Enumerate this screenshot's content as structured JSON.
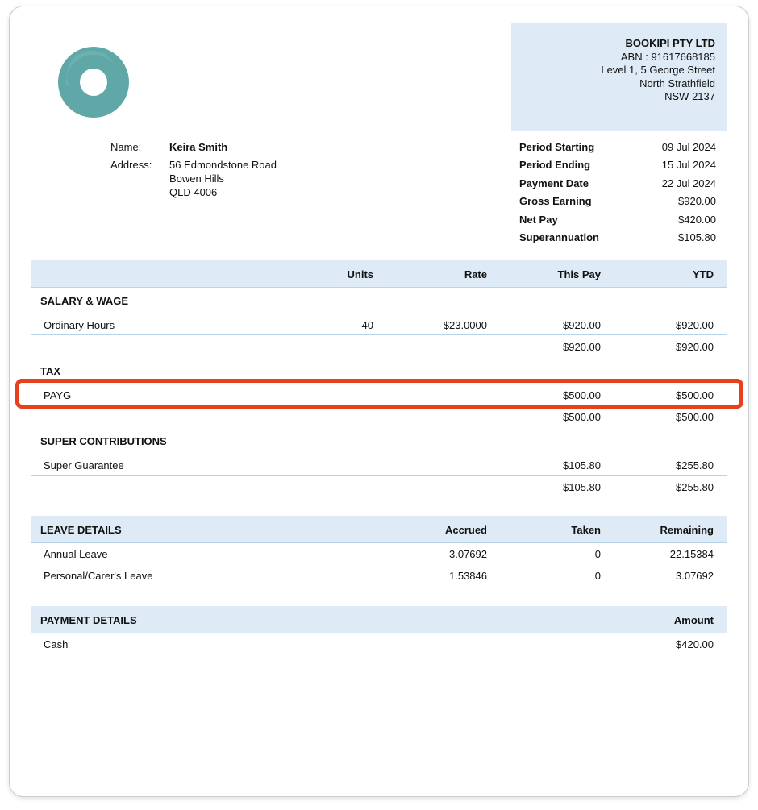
{
  "company": {
    "name": "BOOKIPI PTY LTD",
    "abn": "ABN : 91617668185",
    "address_line1": "Level 1, 5 George Street",
    "address_line2": "North Strathfield",
    "address_line3": "NSW 2137"
  },
  "employee": {
    "name_label": "Name:",
    "name": "Keira Smith",
    "address_label": "Address:",
    "address_line1": "56 Edmondstone Road",
    "address_line2": "Bowen Hills",
    "address_line3": "QLD 4006"
  },
  "summary": [
    {
      "label": "Period Starting",
      "value": "09 Jul 2024"
    },
    {
      "label": "Period Ending",
      "value": "15 Jul 2024"
    },
    {
      "label": "Payment Date",
      "value": "22 Jul 2024"
    },
    {
      "label": "Gross Earning",
      "value": "$920.00"
    },
    {
      "label": "Net Pay",
      "value": "$420.00"
    },
    {
      "label": "Superannuation",
      "value": "$105.80"
    }
  ],
  "earnings_header": {
    "units": "Units",
    "rate": "Rate",
    "this_pay": "This Pay",
    "ytd": "YTD"
  },
  "salary": {
    "title": "SALARY & WAGE",
    "item": {
      "label": "Ordinary Hours",
      "units": "40",
      "rate": "$23.0000",
      "this_pay": "$920.00",
      "ytd": "$920.00"
    },
    "total_this_pay": "$920.00",
    "total_ytd": "$920.00"
  },
  "tax": {
    "title": "TAX",
    "item": {
      "label": "PAYG",
      "this_pay": "$500.00",
      "ytd": "$500.00"
    },
    "total_this_pay": "$500.00",
    "total_ytd": "$500.00"
  },
  "super": {
    "title": "SUPER CONTRIBUTIONS",
    "item": {
      "label": "Super Guarantee",
      "this_pay": "$105.80",
      "ytd": "$255.80"
    },
    "total_this_pay": "$105.80",
    "total_ytd": "$255.80"
  },
  "leave": {
    "title": "LEAVE DETAILS",
    "accrued": "Accrued",
    "taken": "Taken",
    "remaining": "Remaining",
    "rows": [
      {
        "label": "Annual Leave",
        "accrued": "3.07692",
        "taken": "0",
        "remaining": "22.15384"
      },
      {
        "label": "Personal/Carer's Leave",
        "accrued": "1.53846",
        "taken": "0",
        "remaining": "3.07692"
      }
    ]
  },
  "payment": {
    "title": "PAYMENT DETAILS",
    "amount": "Amount",
    "rows": [
      {
        "label": "Cash",
        "amount": "$420.00"
      }
    ]
  },
  "colors": {
    "band": "#deebf6",
    "highlight": "#e8401c",
    "logo": "#5fa8a7"
  }
}
